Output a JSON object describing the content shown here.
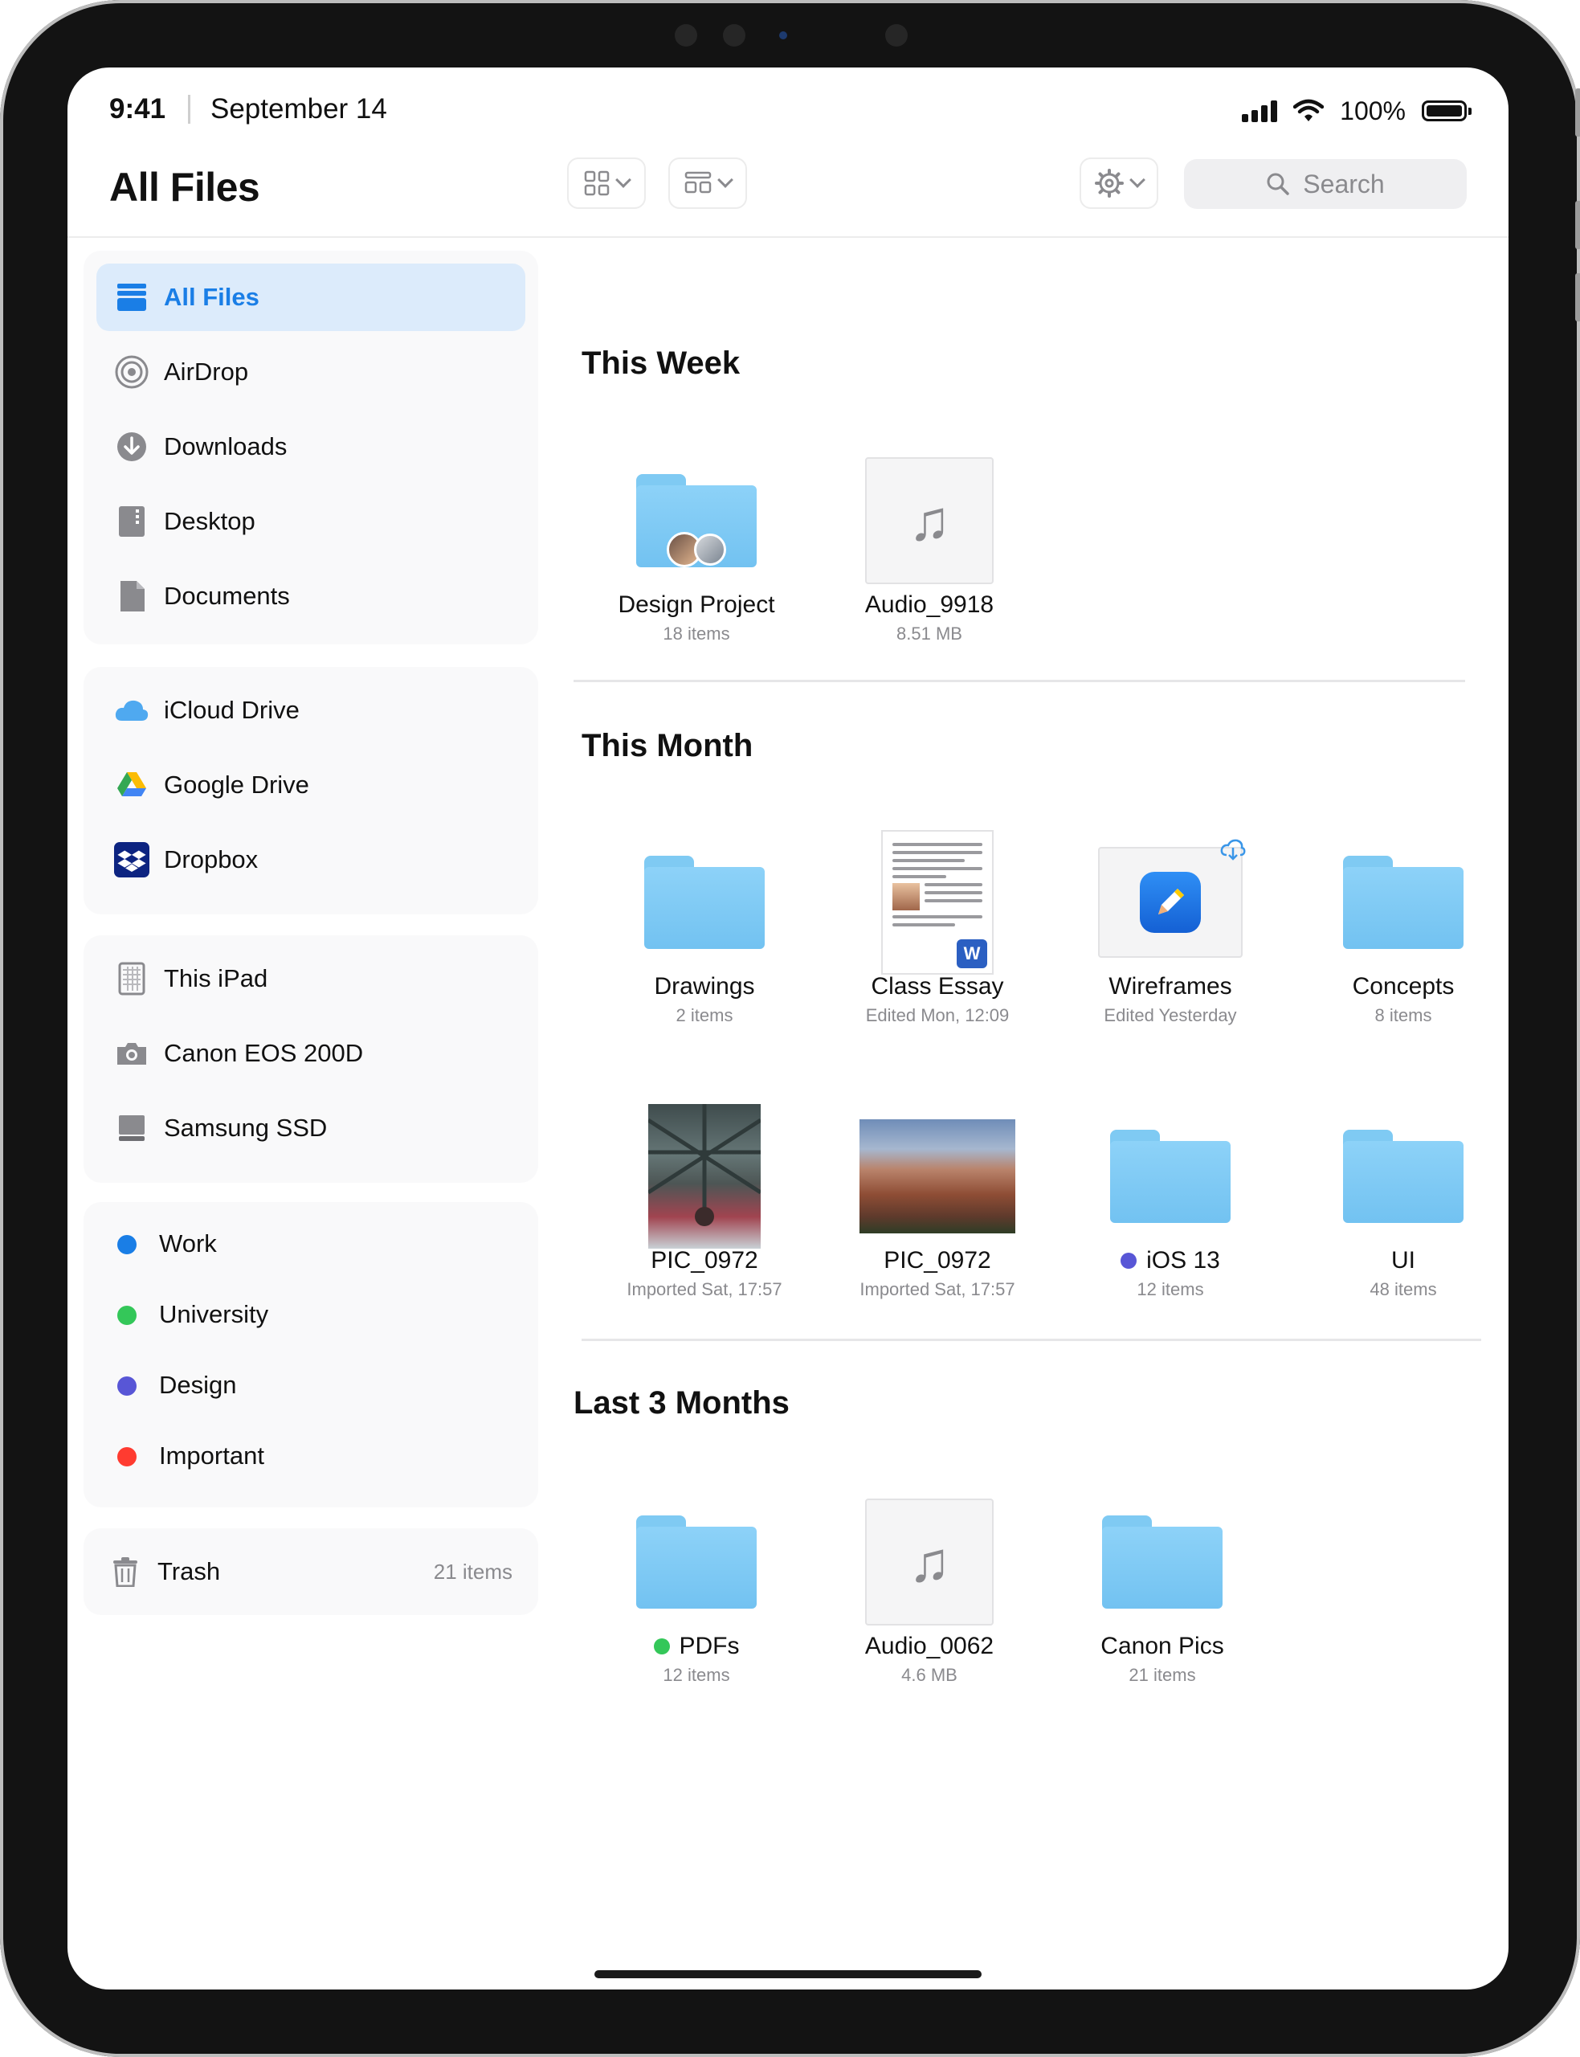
{
  "status": {
    "time": "9:41",
    "date": "September 14",
    "battery": "100%"
  },
  "toolbar": {
    "title": "All Files",
    "search_placeholder": "Search"
  },
  "sidebar": {
    "locations": [
      {
        "label": "All Files",
        "icon": "all-files-icon",
        "active": true
      },
      {
        "label": "AirDrop",
        "icon": "airdrop-icon"
      },
      {
        "label": "Downloads",
        "icon": "downloads-icon"
      },
      {
        "label": "Desktop",
        "icon": "desktop-icon"
      },
      {
        "label": "Documents",
        "icon": "documents-icon"
      }
    ],
    "cloud": [
      {
        "label": "iCloud Drive",
        "icon": "icloud-icon"
      },
      {
        "label": "Google Drive",
        "icon": "google-drive-icon"
      },
      {
        "label": "Dropbox",
        "icon": "dropbox-icon"
      }
    ],
    "devices": [
      {
        "label": "This iPad",
        "icon": "ipad-icon"
      },
      {
        "label": "Canon EOS 200D",
        "icon": "camera-icon"
      },
      {
        "label": "Samsung SSD",
        "icon": "drive-icon"
      }
    ],
    "tags": [
      {
        "label": "Work",
        "color": "#1a7ee6"
      },
      {
        "label": "University",
        "color": "#34c759"
      },
      {
        "label": "Design",
        "color": "#5856d6"
      },
      {
        "label": "Important",
        "color": "#ff3b30"
      }
    ],
    "trash": {
      "label": "Trash",
      "count": "21 items"
    }
  },
  "sections": {
    "this_week": {
      "title": "This Week",
      "items": [
        {
          "name": "Design Project",
          "meta": "18 items",
          "kind": "folder"
        },
        {
          "name": "Audio_9918",
          "meta": "8.51 MB",
          "kind": "audio"
        }
      ]
    },
    "this_month": {
      "title": "This Month",
      "items": [
        {
          "name": "Drawings",
          "meta": "2 items",
          "kind": "folder"
        },
        {
          "name": "Class Essay",
          "meta": "Edited Mon, 12:09",
          "kind": "word-doc"
        },
        {
          "name": "Wireframes",
          "meta": "Edited Yesterday",
          "kind": "app-doc"
        },
        {
          "name": "Concepts",
          "meta": "8 items",
          "kind": "folder"
        },
        {
          "name": "PIC_0972",
          "meta": "Imported Sat, 17:57",
          "kind": "photo"
        },
        {
          "name": "PIC_0972",
          "meta": "Imported Sat, 17:57",
          "kind": "photo"
        },
        {
          "name": "iOS 13",
          "meta": "12 items",
          "kind": "folder",
          "tag": "#5856d6"
        },
        {
          "name": "UI",
          "meta": "48 items",
          "kind": "folder"
        }
      ]
    },
    "last_3_months": {
      "title": "Last 3 Months",
      "items": [
        {
          "name": "PDFs",
          "meta": "12 items",
          "kind": "folder",
          "tag": "#34c759"
        },
        {
          "name": "Audio_0062",
          "meta": "4.6 MB",
          "kind": "audio"
        },
        {
          "name": "Canon Pics",
          "meta": "21 items",
          "kind": "folder"
        }
      ]
    }
  },
  "colors": {
    "accent": "#1a7ee6",
    "folder": "#7fcaf3",
    "sidebar_active_bg": "#dcebfb"
  }
}
